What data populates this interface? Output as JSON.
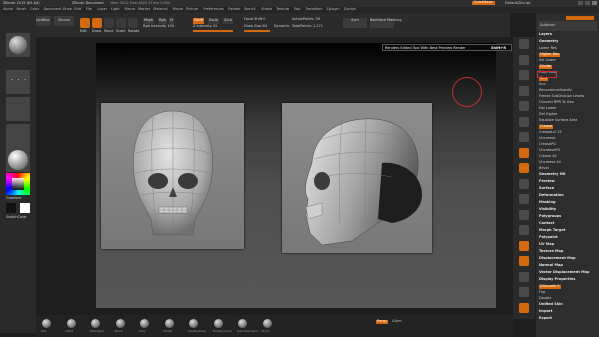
{
  "titlebar": {
    "app": "ZBrush 2019 (64-bit)",
    "doc": "ZBrush Document",
    "mem": "Mem 3012 Free 4823 ZTime 0.000",
    "btn_quicksave": "QuickSave",
    "default_script": "DefaultZScript"
  },
  "menus": [
    "Alpha",
    "Brush",
    "Color",
    "Document",
    "Draw",
    "Edit",
    "File",
    "Layer",
    "Light",
    "Macro",
    "Marker",
    "Material",
    "Movie",
    "Picture",
    "Preferences",
    "Render",
    "Stencil",
    "Stroke",
    "Texture",
    "Tool",
    "Transform",
    "Zplugin",
    "Zscript"
  ],
  "toptools": {
    "projection_master": "Projection Master",
    "lightbox": "LightBox",
    "zbrush_btn": "Zbrush",
    "edit": "Edit",
    "draw": "Draw",
    "move": "Move",
    "scale": "Scale",
    "rotate": "Rotate",
    "mrgb": "Mrgb",
    "rgb": "Rgb",
    "m": "M",
    "zadd": "Zadd",
    "zsub": "Zsub",
    "zcut": "Zcut",
    "rgb_intensity": "Rgb Intensity 100",
    "z_intensity": "Z Intensity 25",
    "focal_shift": "Focal Shift 0",
    "draw_size": "Draw Size 64",
    "active_points": "ActivePoints: 59",
    "total_points": "TotalPoints: 1.171",
    "dynamic": "Dynamic",
    "sym_label": "Sym",
    "backface": "Backface Masking"
  },
  "leftcolors": {
    "gradient": "Gradient",
    "switch": "SwitchColor"
  },
  "tooltip": "Renders Edited Tool With Best Preview Render",
  "tooltip_hotkey": "Shift+R",
  "rightpanel": {
    "layers": "Layers",
    "subtract": "Subtract",
    "items": [
      "Geometry",
      "Lower Res",
      "Higher Res",
      "Sel Lower",
      "Divide",
      "Edge Loop",
      "Smt",
      "Suv",
      "ReconstructSubdiv",
      "Freeze SubDivision Levels",
      "Convert BPR To Geo",
      "Del Lower",
      "Del Higher",
      "Equalize Surface Area",
      "Crease",
      "CreaseLvl 15",
      "Uncrease",
      "CreasePG",
      "UncreasePG",
      "Crease All",
      "Uncrease All",
      "Bevel",
      "Geometry HD",
      "Preview",
      "Surface",
      "Deformation",
      "Masking",
      "Visibility",
      "Polygroups",
      "Contact",
      "Morph Target",
      "Polypaint",
      "UV Map",
      "Texture Map",
      "Displacement Map",
      "Normal Map",
      "Vector Displacement Map",
      "Display Properties",
      "DSmooth 0",
      "Flip",
      "Double",
      "Unified Skin",
      "Import",
      "Export"
    ],
    "divide_highlight": "Divide"
  },
  "bottombar": {
    "items": [
      "Std",
      "Inflat",
      "Standard",
      "Move",
      "Clay",
      "Polish",
      "ClayBuildup",
      "TrimDynamic",
      "DamStandard",
      "Pinch"
    ],
    "floor_label": "Persp",
    "lsym": "LSym"
  }
}
